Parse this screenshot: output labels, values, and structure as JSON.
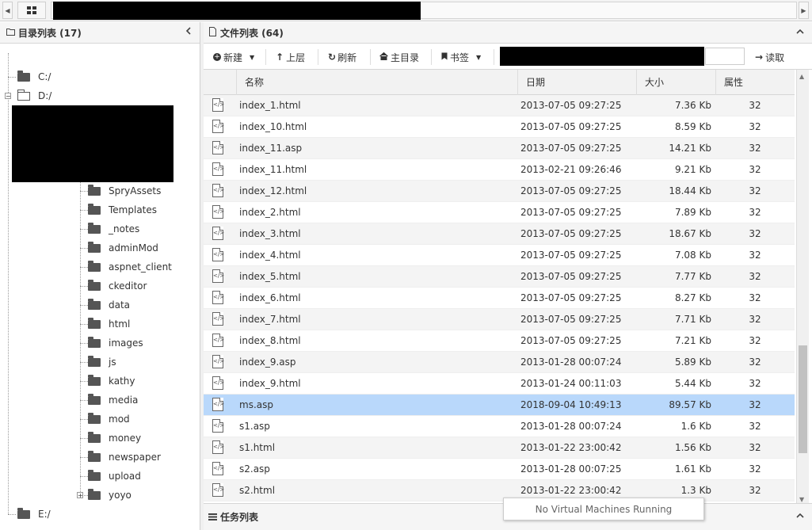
{
  "left_panel": {
    "title": "目录列表 (17)",
    "drives": [
      "C:/",
      "D:/",
      "E:/"
    ],
    "folders": [
      "SpryAssets",
      "Templates",
      "_notes",
      "adminMod",
      "aspnet_client",
      "ckeditor",
      "data",
      "html",
      "images",
      "js",
      "kathy",
      "media",
      "mod",
      "money",
      "newspaper",
      "upload",
      "yoyo"
    ]
  },
  "right_panel": {
    "title": "文件列表 (64)",
    "toolbar": {
      "new": "新建",
      "up": "上层",
      "refresh": "刷新",
      "home": "主目录",
      "bookmark": "书签",
      "read": "读取"
    },
    "columns": [
      "名称",
      "日期",
      "大小",
      "属性"
    ],
    "files": [
      {
        "name": "index_1.html",
        "date": "2013-07-05 09:27:25",
        "size": "7.36 Kb",
        "attr": "32"
      },
      {
        "name": "index_10.html",
        "date": "2013-07-05 09:27:25",
        "size": "8.59 Kb",
        "attr": "32"
      },
      {
        "name": "index_11.asp",
        "date": "2013-07-05 09:27:25",
        "size": "14.21 Kb",
        "attr": "32"
      },
      {
        "name": "index_11.html",
        "date": "2013-02-21 09:26:46",
        "size": "9.21 Kb",
        "attr": "32"
      },
      {
        "name": "index_12.html",
        "date": "2013-07-05 09:27:25",
        "size": "18.44 Kb",
        "attr": "32"
      },
      {
        "name": "index_2.html",
        "date": "2013-07-05 09:27:25",
        "size": "7.89 Kb",
        "attr": "32"
      },
      {
        "name": "index_3.html",
        "date": "2013-07-05 09:27:25",
        "size": "18.67 Kb",
        "attr": "32"
      },
      {
        "name": "index_4.html",
        "date": "2013-07-05 09:27:25",
        "size": "7.08 Kb",
        "attr": "32"
      },
      {
        "name": "index_5.html",
        "date": "2013-07-05 09:27:25",
        "size": "7.77 Kb",
        "attr": "32"
      },
      {
        "name": "index_6.html",
        "date": "2013-07-05 09:27:25",
        "size": "8.27 Kb",
        "attr": "32"
      },
      {
        "name": "index_7.html",
        "date": "2013-07-05 09:27:25",
        "size": "7.71 Kb",
        "attr": "32"
      },
      {
        "name": "index_8.html",
        "date": "2013-07-05 09:27:25",
        "size": "7.21 Kb",
        "attr": "32"
      },
      {
        "name": "index_9.asp",
        "date": "2013-01-28 00:07:24",
        "size": "5.89 Kb",
        "attr": "32"
      },
      {
        "name": "index_9.html",
        "date": "2013-01-24 00:11:03",
        "size": "5.44 Kb",
        "attr": "32"
      },
      {
        "name": "ms.asp",
        "date": "2018-09-04 10:49:13",
        "size": "89.57 Kb",
        "attr": "32",
        "selected": true
      },
      {
        "name": "s1.asp",
        "date": "2013-01-28 00:07:24",
        "size": "1.6 Kb",
        "attr": "32"
      },
      {
        "name": "s1.html",
        "date": "2013-01-22 23:00:42",
        "size": "1.56 Kb",
        "attr": "32"
      },
      {
        "name": "s2.asp",
        "date": "2013-01-28 00:07:25",
        "size": "1.61 Kb",
        "attr": "32"
      },
      {
        "name": "s2.html",
        "date": "2013-01-22 23:00:42",
        "size": "1.3 Kb",
        "attr": "32"
      }
    ]
  },
  "taskbar": {
    "title": "任务列表"
  },
  "vm_popup": {
    "text": "No Virtual Machines Running"
  },
  "file_icon_glyph": "</>",
  "colors": {
    "selected_row": "#b9d8fb",
    "alt_row": "#f4f4f4"
  }
}
